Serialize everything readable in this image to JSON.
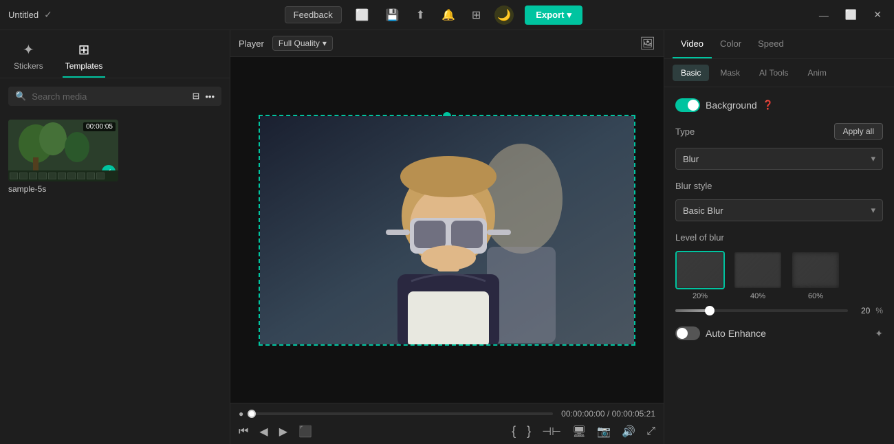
{
  "titlebar": {
    "title": "Untitled",
    "feedback_label": "Feedback",
    "export_label": "Export",
    "export_arrow": "▾"
  },
  "left_panel": {
    "tabs": [
      {
        "id": "stickers",
        "label": "Stickers",
        "icon": "✦",
        "active": false
      },
      {
        "id": "templates",
        "label": "Templates",
        "icon": "⊞",
        "active": true
      }
    ],
    "search_placeholder": "Search media",
    "media_items": [
      {
        "label": "sample-5s",
        "duration": "00:00:05",
        "checked": true
      }
    ]
  },
  "player": {
    "label": "Player",
    "quality": "Full Quality",
    "current_time": "00:00:00:00",
    "total_time": "00:00:05:21"
  },
  "right_panel": {
    "tabs": [
      "Video",
      "Color",
      "Speed"
    ],
    "active_tab": "Video",
    "subtabs": [
      "Basic",
      "Mask",
      "AI Tools",
      "Anim"
    ],
    "active_subtab": "Basic",
    "background_label": "Background",
    "background_enabled": true,
    "type_label": "Type",
    "apply_all_label": "Apply all",
    "type_value": "Blur",
    "blur_style_label": "Blur style",
    "blur_style_value": "Basic Blur",
    "level_label": "Level of blur",
    "blur_options": [
      {
        "pct": "20%",
        "selected": true
      },
      {
        "pct": "40%",
        "selected": false
      },
      {
        "pct": "60%",
        "selected": false
      }
    ],
    "slider_value": "20",
    "slider_unit": "%",
    "auto_enhance_label": "Auto Enhance",
    "auto_enhance_enabled": false
  }
}
